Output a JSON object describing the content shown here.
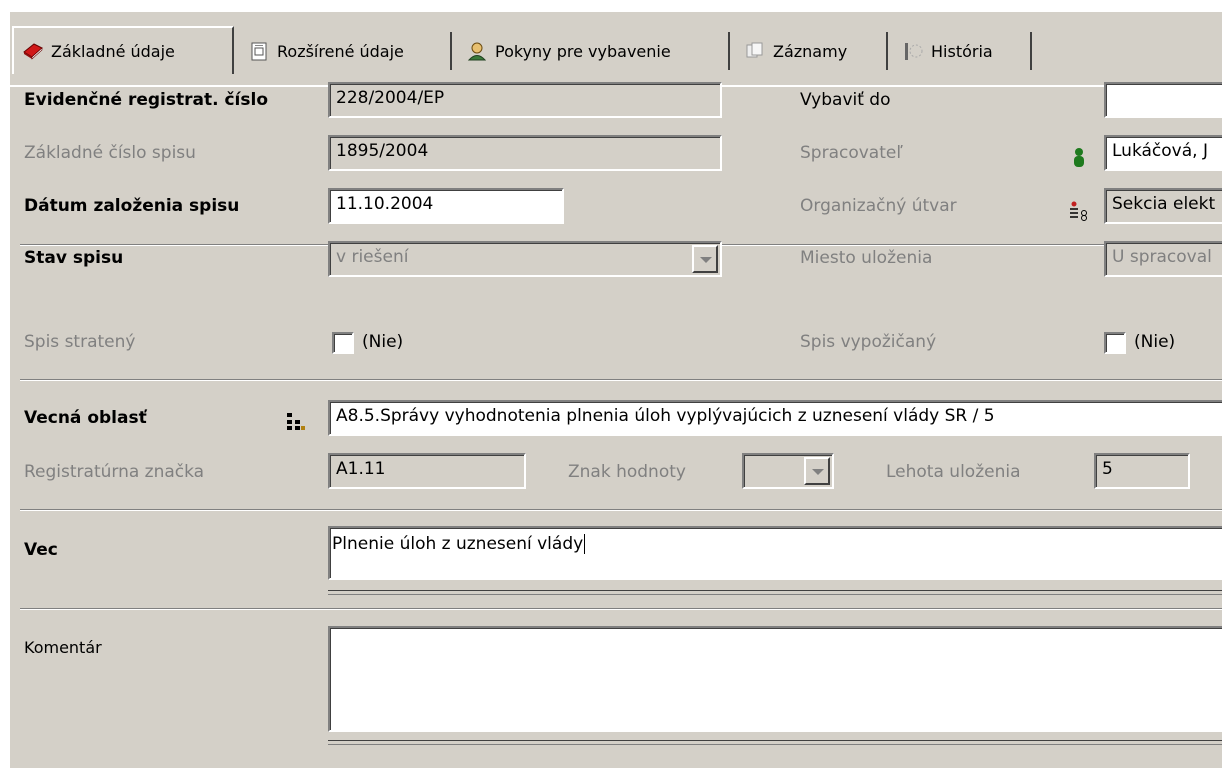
{
  "tabs": [
    {
      "label": "Základné údaje",
      "icon": "red-book-icon"
    },
    {
      "label": "Rozšírené údaje",
      "icon": "document-icon"
    },
    {
      "label": "Pokyny pre vybavenie",
      "icon": "person-icon"
    },
    {
      "label": "Záznamy",
      "icon": "records-icon"
    },
    {
      "label": "História",
      "icon": "history-icon"
    }
  ],
  "form": {
    "evid_label": "Evidenčné registrat. číslo",
    "evid_value": "228/2004/EP",
    "zakl_label": "Základné číslo spisu",
    "zakl_value": "1895/2004",
    "datum_label": "Dátum založenia spisu",
    "datum_value": "11.10.2004",
    "vybavit_label": "Vybaviť do",
    "vybavit_value": "",
    "spracovatel_label": "Spracovateľ",
    "spracovatel_value": "Lukáčová, J",
    "org_label": "Organizačný útvar",
    "org_value": "Sekcia elekt",
    "stav_label": "Stav spisu",
    "stav_value": "v riešení",
    "miesto_label": "Miesto uloženia",
    "miesto_value": "U spracoval",
    "stratený_label": "Spis stratený",
    "strateny_check": "(Nie)",
    "vypozicany_label": "Spis vypožičaný",
    "vypozicany_check": "(Nie)",
    "vecna_label": "Vecná oblasť",
    "vecna_value": "A8.5.Správy vyhodnotenia plnenia úloh vyplývajúcich z uznesení vlády SR / 5",
    "regzn_label": "Registratúrna značka",
    "regzn_value": "A1.11",
    "znak_label": "Znak hodnoty",
    "znak_value": "",
    "lehota_label": "Lehota uloženia",
    "lehota_value": "5",
    "vec_label": "Vec",
    "vec_value": "Plnenie úloh z uznesení vlády",
    "komentar_label": "Komentár",
    "komentar_value": ""
  },
  "colors": {
    "panel": "#d4d0c8",
    "disabled_text": "#808080",
    "person_icon": "#1e7a1e"
  }
}
